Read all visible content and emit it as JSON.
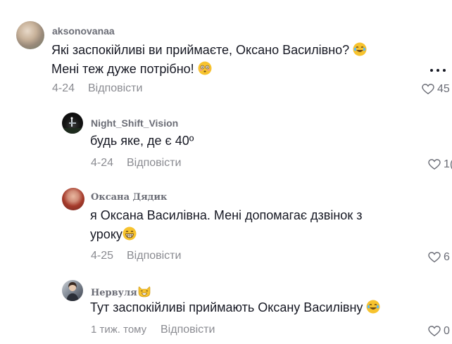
{
  "comments": [
    {
      "username": "aksonovanaa",
      "text_lines": [
        "Які заспокійливі ви приймаєте, Оксано Василівно?",
        "Мені теж дуже потрібно!"
      ],
      "emojis": [
        "tears-of-joy-emoji",
        "flushed-face-emoji"
      ],
      "date": "4-24",
      "reply_label": "Відповісти",
      "likes": "45"
    },
    {
      "username": "Night_Shift_Vision",
      "text_lines": [
        "будь яке, де є 40º"
      ],
      "date": "4-24",
      "reply_label": "Відповісти",
      "likes": "1("
    },
    {
      "username": "Оксана Дядик",
      "text_lines": [
        "я Оксана Василівна. Мені допомагає дзвінок з",
        "уроку"
      ],
      "emojis": [
        "grinning-emoji"
      ],
      "date": "4-25",
      "reply_label": "Відповісти",
      "likes": "6"
    },
    {
      "username": "Нервуля",
      "emojis": [
        "cat-emoji",
        "tears-of-joy-emoji"
      ],
      "text_lines": [
        "Тут заспокійливі приймають Оксану Василівну"
      ],
      "date": "1 тиж. тому",
      "reply_label": "Відповісти",
      "likes": "0"
    }
  ],
  "icons": {
    "like": "heart-outline-icon",
    "more": "more-dots-icon"
  },
  "colors": {
    "text": "#161823",
    "muted": "#8a8b91",
    "username": "#6b6d76",
    "emoji": "#f7c32e"
  }
}
